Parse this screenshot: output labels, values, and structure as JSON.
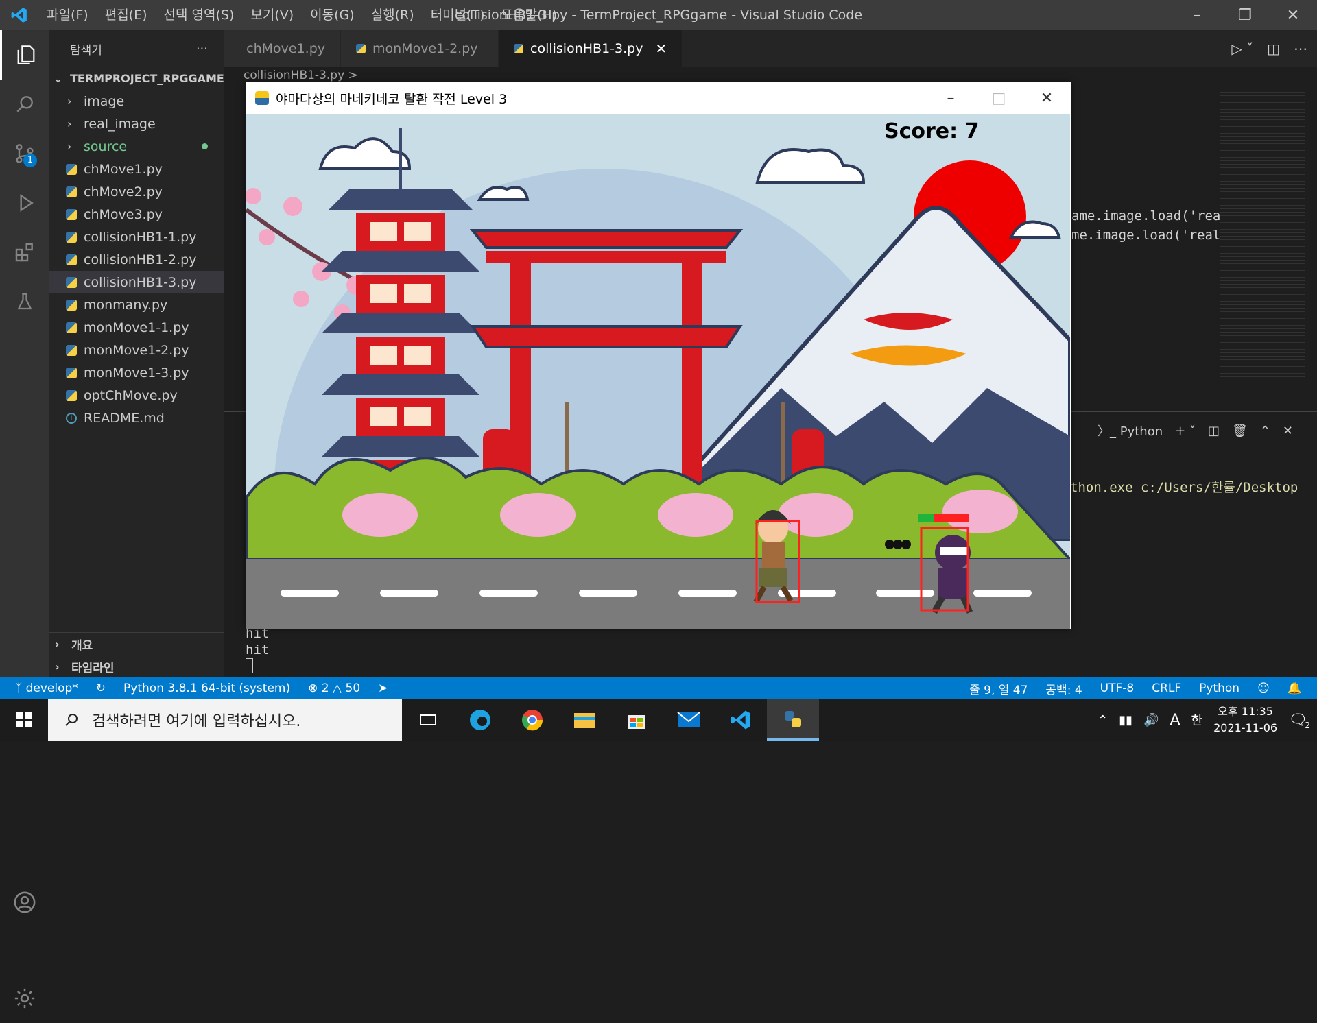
{
  "window": {
    "menu": [
      "파일(F)",
      "편집(E)",
      "선택 영역(S)",
      "보기(V)",
      "이동(G)",
      "실행(R)",
      "터미널(T)",
      "도움말(H)"
    ],
    "title": "collisionHB1-3.py - TermProject_RPGgame - Visual Studio Code"
  },
  "activity": {
    "scm_badge": "1"
  },
  "sidebar": {
    "header": "탐색기",
    "project": "TERMPROJECT_RPGGAME",
    "folders": [
      "image",
      "real_image",
      "source"
    ],
    "files": [
      "chMove1.py",
      "chMove2.py",
      "chMove3.py",
      "collisionHB1-1.py",
      "collisionHB1-2.py",
      "collisionHB1-3.py",
      "monmany.py",
      "monMove1-1.py",
      "monMove1-2.py",
      "monMove1-3.py",
      "optChMove.py"
    ],
    "readme": "README.md",
    "outline": "개요",
    "timeline": "타임라인"
  },
  "tabs": [
    "chMove1.py",
    "monMove1-2.py",
    "collisionHB1-3.py"
  ],
  "breadcrumb": "collisionHB1-3.py >",
  "code_lines": [
    "ame.image.load('rea",
    "me.image.load('real"
  ],
  "terminal": {
    "shell": "Python",
    "line": "thon.exe c:/Users/한률/Desktop",
    "outputs": [
      "hit",
      "hit"
    ]
  },
  "game": {
    "title": "야마다상의 마네키네코 탈환 작전 Level 3",
    "score": "Score: 7",
    "hp_fraction": 0.3
  },
  "status": {
    "branch": "develop*",
    "interpreter": "Python 3.8.1 64-bit (system)",
    "errors": "2",
    "warnings": "50",
    "position": "줄 9, 열 47",
    "spaces": "공백: 4",
    "encoding": "UTF-8",
    "eol": "CRLF",
    "language": "Python"
  },
  "taskbar": {
    "search_placeholder": "검색하려면 여기에 입력하십시오.",
    "ime": "A",
    "ime2": "한",
    "time": "오후 11:35",
    "date": "2021-11-06",
    "notifications": "2"
  }
}
